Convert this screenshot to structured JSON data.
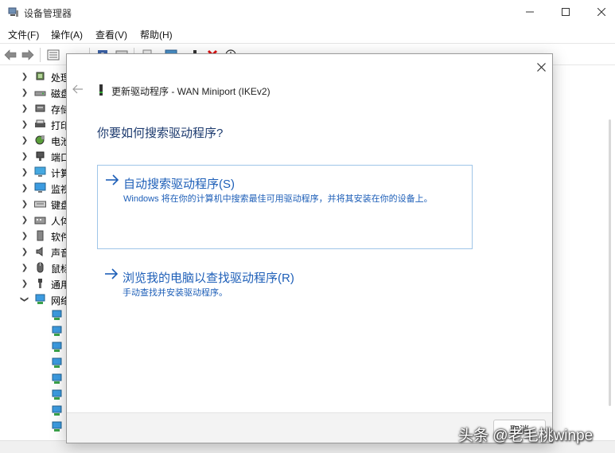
{
  "window": {
    "title": "设备管理器"
  },
  "menu": [
    {
      "label": "文件(F)"
    },
    {
      "label": "操作(A)"
    },
    {
      "label": "查看(V)"
    },
    {
      "label": "帮助(H)"
    }
  ],
  "tree": {
    "items": [
      {
        "label": "处理",
        "icon": "processor-icon",
        "expanded": false
      },
      {
        "label": "磁盘",
        "icon": "disk-icon",
        "expanded": false
      },
      {
        "label": "存储",
        "icon": "storage-icon",
        "expanded": false
      },
      {
        "label": "打印",
        "icon": "printer-icon",
        "expanded": false
      },
      {
        "label": "电池",
        "icon": "battery-icon",
        "expanded": false
      },
      {
        "label": "端口",
        "icon": "port-icon",
        "expanded": false
      },
      {
        "label": "计算",
        "icon": "computer-icon",
        "expanded": false
      },
      {
        "label": "监视",
        "icon": "monitor-icon",
        "expanded": false
      },
      {
        "label": "键盘",
        "icon": "keyboard-icon",
        "expanded": false
      },
      {
        "label": "人体",
        "icon": "hid-icon",
        "expanded": false
      },
      {
        "label": "软件",
        "icon": "software-icon",
        "expanded": false
      },
      {
        "label": "声音",
        "icon": "sound-icon",
        "expanded": false
      },
      {
        "label": "鼠标",
        "icon": "mouse-icon",
        "expanded": false
      },
      {
        "label": "通用",
        "icon": "usb-icon",
        "expanded": false
      },
      {
        "label": "网络",
        "icon": "network-icon",
        "expanded": true
      }
    ],
    "network_children_count_visible": 8
  },
  "dialog": {
    "title": "更新驱动程序 - WAN Miniport (IKEv2)",
    "heading": "你要如何搜索驱动程序?",
    "options": [
      {
        "title": "自动搜索驱动程序(S)",
        "description": "Windows 将在你的计算机中搜索最佳可用驱动程序，并将其安装在你的设备上。"
      },
      {
        "title": "浏览我的电脑以查找驱动程序(R)",
        "description": "手动查找并安装驱动程序。"
      }
    ],
    "cancel_label": "取消"
  },
  "watermark": {
    "text": "头条 @老毛桃winpe"
  },
  "colors": {
    "link_blue": "#1e5fb8",
    "heading_blue": "#1c3a6e",
    "option_border": "#9fc5e8"
  }
}
